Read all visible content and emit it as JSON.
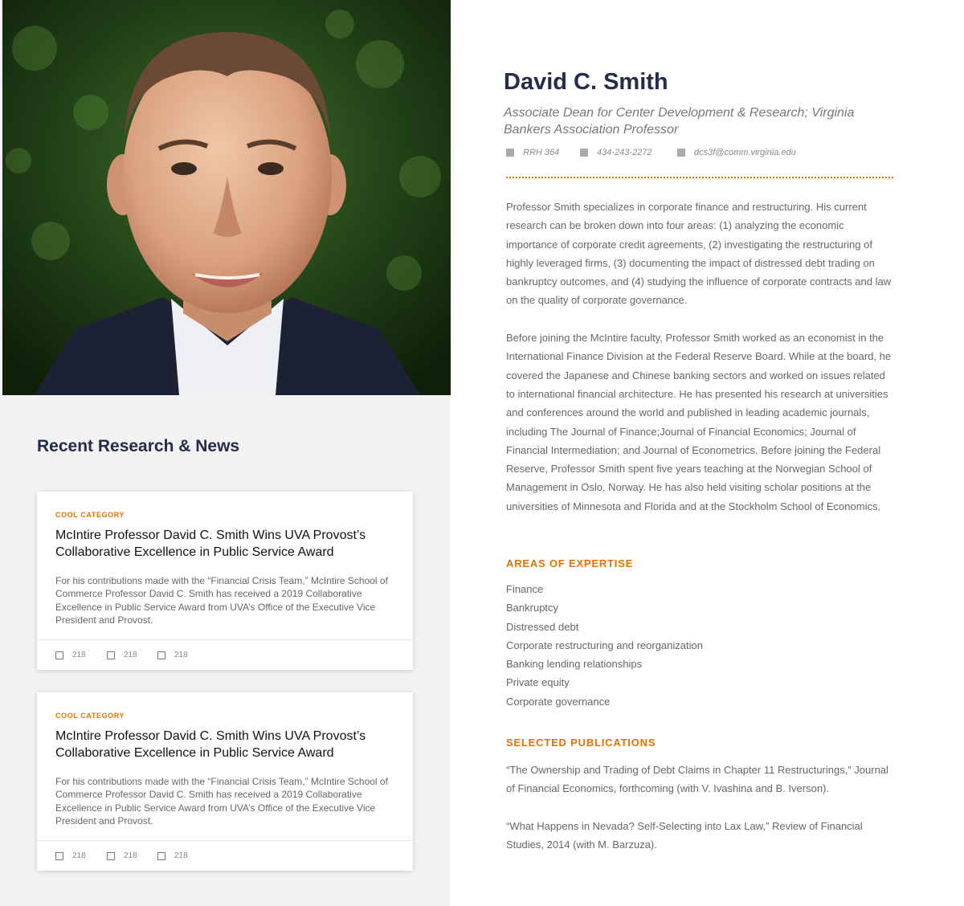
{
  "profile": {
    "name": "David C. Smith",
    "title": "Associate Dean for Center Development & Research; Virginia Bankers Association Professor",
    "office": "RRH 364",
    "phone": "434-243-2272",
    "email": "dcs3f@comm.virginia.edu",
    "photo_icon": "portrait-photo"
  },
  "bio": {
    "paragraphs": [
      "Professor Smith specializes in corporate finance and restructuring. His current research can be broken down into four areas: (1) analyzing the economic importance of corporate credit agreements, (2) investigating the restructuring of highly leveraged firms, (3) documenting the impact of distressed debt trading on bankruptcy outcomes, and (4) studying the influence of corporate contracts and law on the quality of corporate governance.",
      "Before joining the McIntire faculty, Professor Smith worked as an economist in the International Finance Division at the Federal Reserve Board. While at the board, he covered the Japanese and Chinese banking sectors and worked on issues related to international financial architecture. He has presented his research at universities and conferences around the world and published in leading academic journals, including The Journal of Finance;Journal of Financial Economics; Journal of Financial Intermediation; and Journal of Econometrics. Before joining the Federal Reserve, Professor Smith spent five years teaching at the Norwegian School of Management in Oslo, Norway. He has also held visiting scholar positions at the universities of Minnesota and Florida and at the Stockholm School of Economics."
    ]
  },
  "expertise": {
    "heading": "Areas of Expertise",
    "items": [
      "Finance",
      "Bankruptcy",
      "Distressed debt",
      "Corporate restructuring and reorganization",
      "Banking lending relationships",
      "Private equity",
      "Corporate governance"
    ]
  },
  "publications": {
    "heading": "Selected Publications",
    "items": [
      "“The Ownership and Trading of Debt Claims in Chapter 11 Restructurings,” Journal of Financial Economics, forthcoming (with V. Ivashina and B. Iverson).",
      "“What Happens in Nevada? Self-Selecting into Lax Law,” Review of Financial Studies, 2014 (with M. Barzuza)."
    ]
  },
  "news": {
    "heading": "Recent Research & News",
    "cards": [
      {
        "category": "Cool Category",
        "title": "McIntire Professor David C. Smith Wins UVA Provost’s Collaborative Excellence in Public Service Award",
        "text": "For his contributions made with the “Financial Crisis Team,” McIntire School of Commerce Professor David C. Smith has received a 2019 Collaborative Excellence in Public Service Award from UVA’s Office of the Executive Vice President and Provost.",
        "stats": [
          "218",
          "218",
          "218"
        ]
      },
      {
        "category": "Cool Category",
        "title": "McIntire Professor David C. Smith Wins UVA Provost’s Collaborative Excellence in Public Service Award",
        "text": "For his contributions made with the “Financial Crisis Team,” McIntire School of Commerce Professor David C. Smith has received a 2019 Collaborative Excellence in Public Service Award from UVA’s Office of the Executive Vice President and Provost.",
        "stats": [
          "218",
          "218",
          "218"
        ]
      }
    ]
  },
  "colors": {
    "navy": "#232d4b",
    "orange": "#e57200",
    "panel_gray": "#f2f2f2"
  }
}
